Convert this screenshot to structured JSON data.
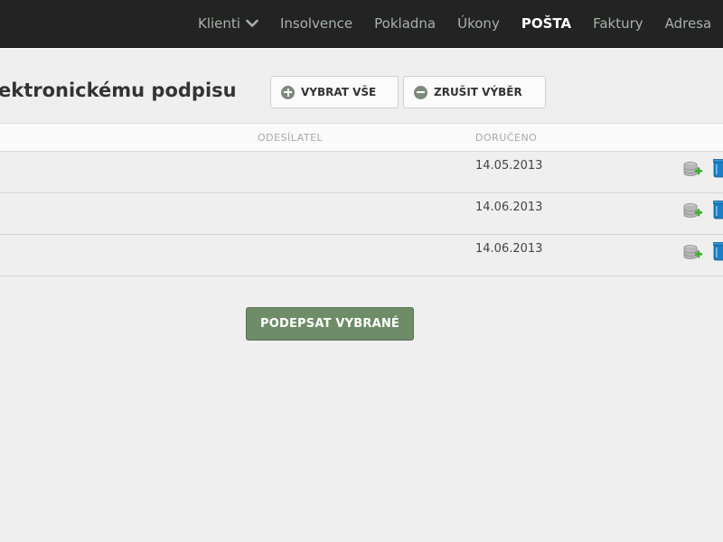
{
  "nav": {
    "items": [
      {
        "label": "Klienti",
        "has_dropdown": true
      },
      {
        "label": "Insolvence"
      },
      {
        "label": "Pokladna"
      },
      {
        "label": "Úkony"
      },
      {
        "label": "POŠTA",
        "active": true
      },
      {
        "label": "Faktury"
      },
      {
        "label": "Adresa"
      }
    ]
  },
  "page": {
    "title": "ektronickému podpisu",
    "select_all_label": "VYBRAT VŠE",
    "deselect_label": "ZRUŠIT VÝBĚR"
  },
  "table": {
    "columns": {
      "sender": "ODESÍLATEL",
      "delivered": "DORUČENO"
    },
    "rows": [
      {
        "delivered": "14.05.2013"
      },
      {
        "delivered": "14.06.2013"
      },
      {
        "delivered": "14.06.2013"
      }
    ]
  },
  "actions": {
    "sign_selected_label": "PODEPSAT VYBRANÉ"
  },
  "icons": {
    "add_to_db": "database-add-icon",
    "delete": "trash-bin-icon"
  },
  "colors": {
    "topbar": "#232323",
    "nav_text": "#a7b3a8",
    "accent_green": "#6f8c69",
    "background": "#efefef"
  }
}
